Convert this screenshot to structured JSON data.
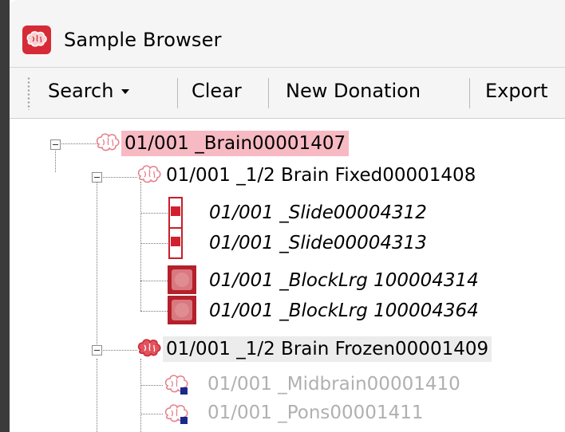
{
  "window": {
    "title": "Sample Browser",
    "app_icon": "brain-icon",
    "accent_color": "#d62b36"
  },
  "toolbar": {
    "search_label": "Search",
    "clear_label": "Clear",
    "new_donation_label": "New Donation",
    "export_label": "Export"
  },
  "tree": {
    "nodes": [
      {
        "label": "01/001 _Brain00001407",
        "icon": "brain-outline-icon",
        "state": "selected"
      },
      {
        "label": "01/001 _1/2 Brain Fixed00001408",
        "icon": "brain-outline-icon",
        "state": "normal"
      },
      {
        "label": "01/001 _Slide00004312",
        "icon": "slide-icon",
        "state": "italic"
      },
      {
        "label": "01/001 _Slide00004313",
        "icon": "slide-icon",
        "state": "italic"
      },
      {
        "label": "01/001 _BlockLrg 100004314",
        "icon": "block-icon",
        "state": "italic"
      },
      {
        "label": "01/001 _BlockLrg 100004364",
        "icon": "block-icon",
        "state": "italic"
      },
      {
        "label": "01/001 _1/2 Brain Frozen00001409",
        "icon": "brain-filled-icon",
        "state": "hover"
      },
      {
        "label": "01/001 _Midbrain00001410",
        "icon": "brain-tag-icon",
        "state": "disabled"
      },
      {
        "label": "01/001 _Pons00001411",
        "icon": "brain-tag-icon",
        "state": "disabled"
      }
    ]
  }
}
